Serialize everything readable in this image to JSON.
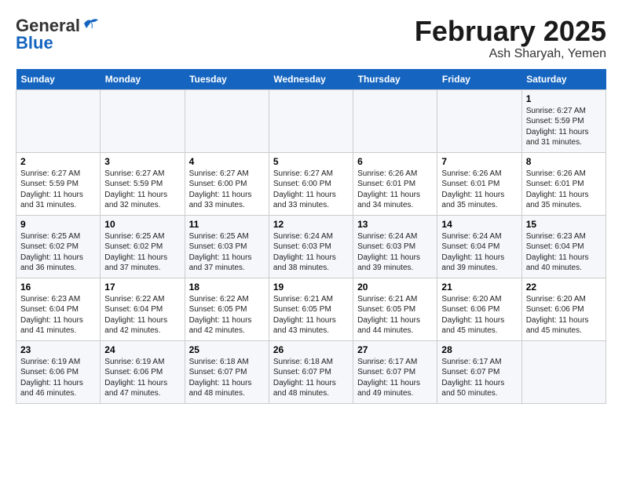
{
  "header": {
    "logo_general": "General",
    "logo_blue": "Blue",
    "title": "February 2025",
    "subtitle": "Ash Sharyah, Yemen"
  },
  "days_of_week": [
    "Sunday",
    "Monday",
    "Tuesday",
    "Wednesday",
    "Thursday",
    "Friday",
    "Saturday"
  ],
  "weeks": [
    [
      {
        "day": "",
        "info": ""
      },
      {
        "day": "",
        "info": ""
      },
      {
        "day": "",
        "info": ""
      },
      {
        "day": "",
        "info": ""
      },
      {
        "day": "",
        "info": ""
      },
      {
        "day": "",
        "info": ""
      },
      {
        "day": "1",
        "info": "Sunrise: 6:27 AM\nSunset: 5:59 PM\nDaylight: 11 hours\nand 31 minutes."
      }
    ],
    [
      {
        "day": "2",
        "info": "Sunrise: 6:27 AM\nSunset: 5:59 PM\nDaylight: 11 hours\nand 31 minutes."
      },
      {
        "day": "3",
        "info": "Sunrise: 6:27 AM\nSunset: 5:59 PM\nDaylight: 11 hours\nand 32 minutes."
      },
      {
        "day": "4",
        "info": "Sunrise: 6:27 AM\nSunset: 6:00 PM\nDaylight: 11 hours\nand 33 minutes."
      },
      {
        "day": "5",
        "info": "Sunrise: 6:27 AM\nSunset: 6:00 PM\nDaylight: 11 hours\nand 33 minutes."
      },
      {
        "day": "6",
        "info": "Sunrise: 6:26 AM\nSunset: 6:01 PM\nDaylight: 11 hours\nand 34 minutes."
      },
      {
        "day": "7",
        "info": "Sunrise: 6:26 AM\nSunset: 6:01 PM\nDaylight: 11 hours\nand 35 minutes."
      },
      {
        "day": "8",
        "info": "Sunrise: 6:26 AM\nSunset: 6:01 PM\nDaylight: 11 hours\nand 35 minutes."
      }
    ],
    [
      {
        "day": "9",
        "info": "Sunrise: 6:25 AM\nSunset: 6:02 PM\nDaylight: 11 hours\nand 36 minutes."
      },
      {
        "day": "10",
        "info": "Sunrise: 6:25 AM\nSunset: 6:02 PM\nDaylight: 11 hours\nand 37 minutes."
      },
      {
        "day": "11",
        "info": "Sunrise: 6:25 AM\nSunset: 6:03 PM\nDaylight: 11 hours\nand 37 minutes."
      },
      {
        "day": "12",
        "info": "Sunrise: 6:24 AM\nSunset: 6:03 PM\nDaylight: 11 hours\nand 38 minutes."
      },
      {
        "day": "13",
        "info": "Sunrise: 6:24 AM\nSunset: 6:03 PM\nDaylight: 11 hours\nand 39 minutes."
      },
      {
        "day": "14",
        "info": "Sunrise: 6:24 AM\nSunset: 6:04 PM\nDaylight: 11 hours\nand 39 minutes."
      },
      {
        "day": "15",
        "info": "Sunrise: 6:23 AM\nSunset: 6:04 PM\nDaylight: 11 hours\nand 40 minutes."
      }
    ],
    [
      {
        "day": "16",
        "info": "Sunrise: 6:23 AM\nSunset: 6:04 PM\nDaylight: 11 hours\nand 41 minutes."
      },
      {
        "day": "17",
        "info": "Sunrise: 6:22 AM\nSunset: 6:04 PM\nDaylight: 11 hours\nand 42 minutes."
      },
      {
        "day": "18",
        "info": "Sunrise: 6:22 AM\nSunset: 6:05 PM\nDaylight: 11 hours\nand 42 minutes."
      },
      {
        "day": "19",
        "info": "Sunrise: 6:21 AM\nSunset: 6:05 PM\nDaylight: 11 hours\nand 43 minutes."
      },
      {
        "day": "20",
        "info": "Sunrise: 6:21 AM\nSunset: 6:05 PM\nDaylight: 11 hours\nand 44 minutes."
      },
      {
        "day": "21",
        "info": "Sunrise: 6:20 AM\nSunset: 6:06 PM\nDaylight: 11 hours\nand 45 minutes."
      },
      {
        "day": "22",
        "info": "Sunrise: 6:20 AM\nSunset: 6:06 PM\nDaylight: 11 hours\nand 45 minutes."
      }
    ],
    [
      {
        "day": "23",
        "info": "Sunrise: 6:19 AM\nSunset: 6:06 PM\nDaylight: 11 hours\nand 46 minutes."
      },
      {
        "day": "24",
        "info": "Sunrise: 6:19 AM\nSunset: 6:06 PM\nDaylight: 11 hours\nand 47 minutes."
      },
      {
        "day": "25",
        "info": "Sunrise: 6:18 AM\nSunset: 6:07 PM\nDaylight: 11 hours\nand 48 minutes."
      },
      {
        "day": "26",
        "info": "Sunrise: 6:18 AM\nSunset: 6:07 PM\nDaylight: 11 hours\nand 48 minutes."
      },
      {
        "day": "27",
        "info": "Sunrise: 6:17 AM\nSunset: 6:07 PM\nDaylight: 11 hours\nand 49 minutes."
      },
      {
        "day": "28",
        "info": "Sunrise: 6:17 AM\nSunset: 6:07 PM\nDaylight: 11 hours\nand 50 minutes."
      },
      {
        "day": "",
        "info": ""
      }
    ]
  ]
}
